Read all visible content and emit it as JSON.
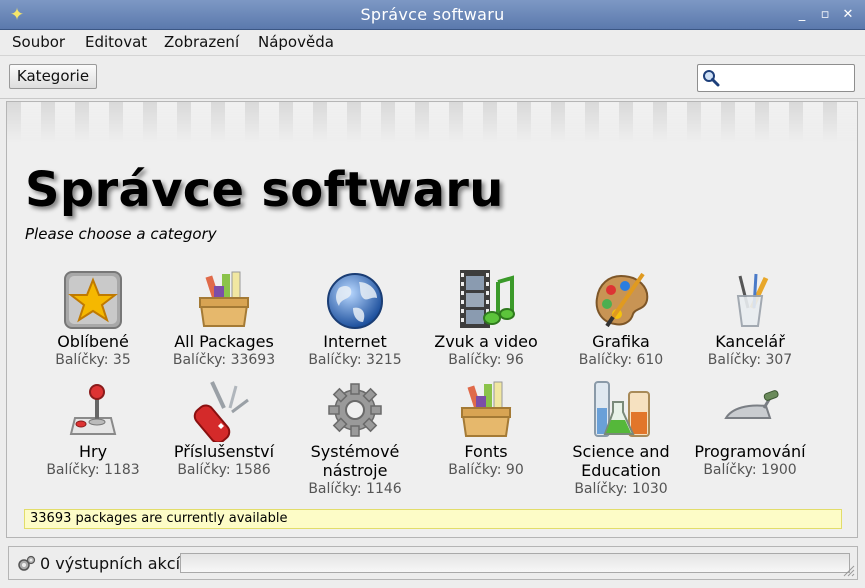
{
  "window": {
    "title": "Správce softwaru"
  },
  "menu": [
    {
      "label": "Soubor"
    },
    {
      "label": "Editovat"
    },
    {
      "label": "Zobrazení"
    },
    {
      "label": "Nápověda"
    }
  ],
  "toolbar": {
    "category_button": "Kategorie",
    "search_value": "",
    "search_placeholder": ""
  },
  "main": {
    "title": "Správce softwaru",
    "subtitle": "Please choose a category",
    "categories": [
      {
        "name": "Oblíbené",
        "count": "Balíčky: 35",
        "icon": "star-icon"
      },
      {
        "name": "All Packages",
        "count": "Balíčky: 33693",
        "icon": "package-box-icon"
      },
      {
        "name": "Internet",
        "count": "Balíčky: 3215",
        "icon": "globe-icon"
      },
      {
        "name": "Zvuk a video",
        "count": "Balíčky: 96",
        "icon": "film-music-icon"
      },
      {
        "name": "Grafika",
        "count": "Balíčky: 610",
        "icon": "palette-icon"
      },
      {
        "name": "Kancelář",
        "count": "Balíčky: 307",
        "icon": "pencil-cup-icon"
      },
      {
        "name": "Hry",
        "count": "Balíčky: 1183",
        "icon": "joystick-icon"
      },
      {
        "name": "Příslušenství",
        "count": "Balíčky: 1586",
        "icon": "swiss-knife-icon"
      },
      {
        "name": "Systémové nástroje",
        "count": "Balíčky: 1146",
        "icon": "gear-icon"
      },
      {
        "name": "Fonts",
        "count": "Balíčky: 90",
        "icon": "package-box-icon"
      },
      {
        "name": "Science and Education",
        "count": "Balíčky: 1030",
        "icon": "lab-flask-icon"
      },
      {
        "name": "Programování",
        "count": "Balíčky: 1900",
        "icon": "trowel-icon"
      }
    ],
    "status": "33693 packages are currently available"
  },
  "statusbar": {
    "text": "0 výstupních akcí"
  },
  "colors": {
    "titlebar": "#6a87b9",
    "status_strip": "#fdfcc7",
    "accent_blue": "#2f5da8"
  }
}
